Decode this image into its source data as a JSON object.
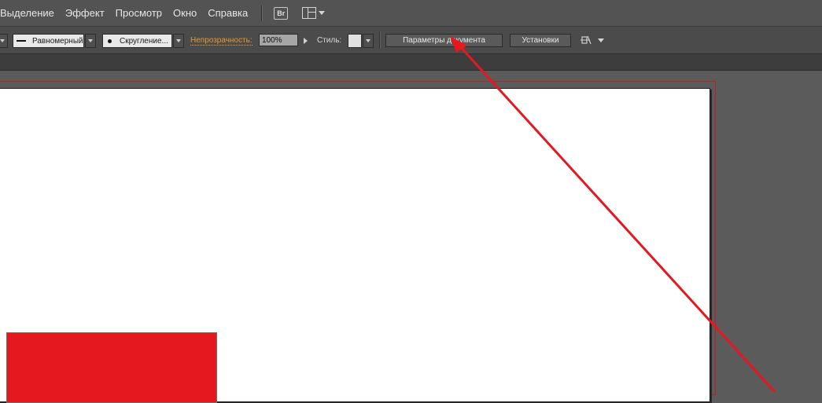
{
  "menubar": {
    "items": [
      "Выделение",
      "Эффект",
      "Просмотр",
      "Окно",
      "Справка"
    ],
    "bridge_label": "Br"
  },
  "controlbar": {
    "stroke_profile": "Равномерный",
    "brush": "Скругление...",
    "opacity_label": "Непрозрачность:",
    "opacity_value": "100%",
    "style_label": "Стиль:",
    "doc_setup_button": "Параметры документа",
    "preferences_button": "Установки"
  },
  "colors": {
    "accent_orange": "#e29a3a",
    "annotation_red": "#e5171f"
  },
  "icons": [
    "bridge-icon",
    "workspace-layout-icon",
    "align-icon"
  ]
}
